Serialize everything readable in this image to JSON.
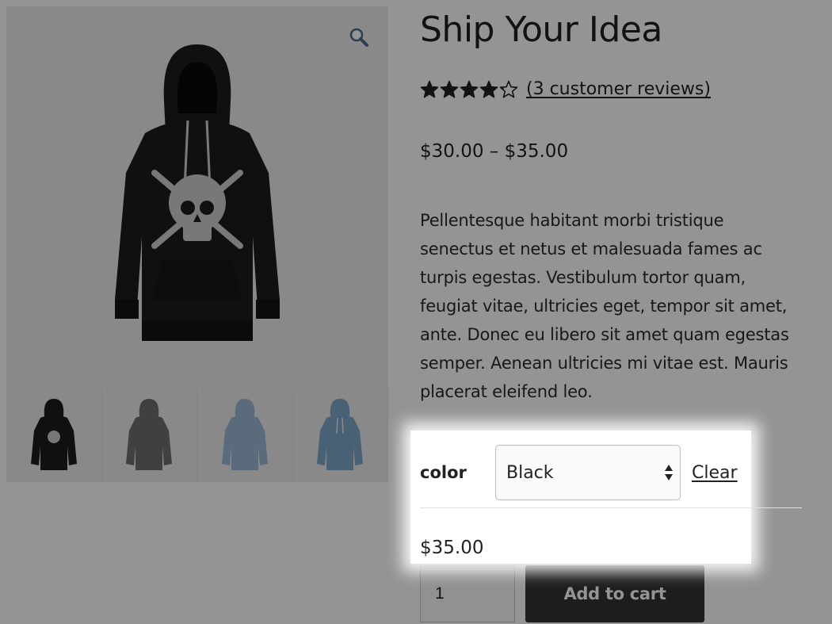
{
  "product": {
    "title": "Ship Your Idea",
    "rating": 4.2,
    "rating_max": 5,
    "reviews_link": "(3 customer reviews)",
    "price_range": "$30.00 – $35.00",
    "description": "Pellentesque habitant morbi tristique senectus et netus et malesuada fames ac turpis egestas. Vestibulum tortor quam, feugiat vitae, ultricies eget, tempor sit amet, ante. Donec eu libero sit amet quam egestas semper. Aenean ultricies mi vitae est. Mauris placerat eleifend leo."
  },
  "gallery": {
    "zoom_icon": "magnifier-icon",
    "thumbnails": [
      {
        "color": "#1c1c1c"
      },
      {
        "color": "#6e6e6e"
      },
      {
        "color": "#9bbad6"
      },
      {
        "color": "#7fa7c9"
      }
    ]
  },
  "variation": {
    "label": "color",
    "selected": "Black",
    "clear_label": "Clear",
    "price": "$35.00"
  },
  "cart": {
    "quantity": "1",
    "add_label": "Add to cart"
  },
  "colors": {
    "button_bg": "#333333",
    "star": "#222222"
  }
}
